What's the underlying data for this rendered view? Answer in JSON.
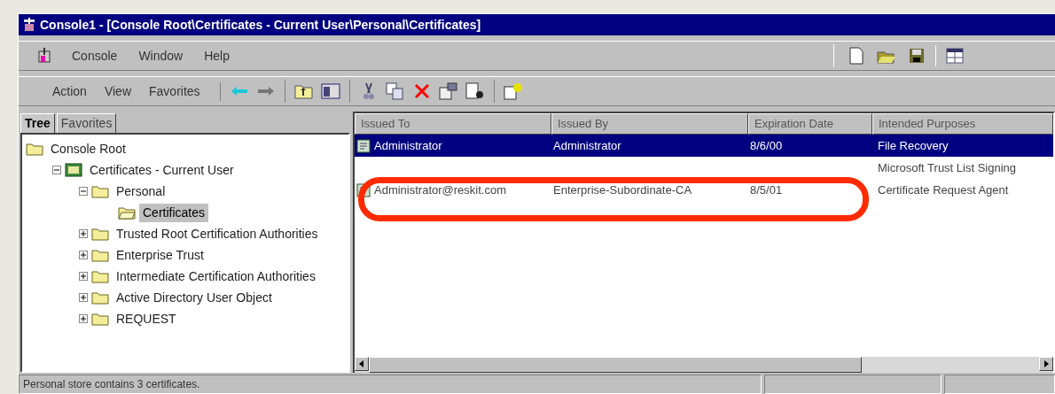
{
  "window": {
    "title": "Console1 - [Console Root\\Certificates - Current User\\Personal\\Certificates]"
  },
  "menu": [
    "Console",
    "Window",
    "Help"
  ],
  "action_menu": [
    "Action",
    "View",
    "Favorites"
  ],
  "tabs": [
    {
      "label": "Tree",
      "selected": true
    },
    {
      "label": "Favorites",
      "selected": false
    }
  ],
  "tree": [
    {
      "label": "Console Root",
      "kind": "folder",
      "selected": false,
      "children": [
        {
          "label": "Certificates - Current User",
          "kind": "snapin",
          "expanded": true,
          "selected": false,
          "children": [
            {
              "label": "Personal",
              "kind": "folder",
              "expanded": true,
              "selected": false,
              "children": [
                {
                  "label": "Certificates",
                  "kind": "folder",
                  "selected": true
                }
              ]
            },
            {
              "label": "Trusted Root Certification Authorities",
              "kind": "folder",
              "expanded": false,
              "selected": false
            },
            {
              "label": "Enterprise Trust",
              "kind": "folder",
              "expanded": false,
              "selected": false
            },
            {
              "label": "Intermediate Certification Authorities",
              "kind": "folder",
              "expanded": false,
              "selected": false
            },
            {
              "label": "Active Directory User Object",
              "kind": "folder",
              "expanded": false,
              "selected": false
            },
            {
              "label": "REQUEST",
              "kind": "folder",
              "expanded": false,
              "selected": false
            }
          ]
        }
      ]
    }
  ],
  "table": {
    "columns": [
      "Issued To",
      "Issued By",
      "Expiration Date",
      "Intended Purposes"
    ],
    "rows": [
      {
        "cells": [
          "Administrator",
          "Administrator",
          "8/6/00",
          "File Recovery"
        ],
        "selected": true
      },
      {
        "cells": [
          "",
          "",
          "",
          "Microsoft Trust List Signing"
        ],
        "selected": false
      },
      {
        "cells": [
          "Administrator@reskit.com",
          "Enterprise-Subordinate-CA",
          "8/5/01",
          "Certificate Request Agent"
        ],
        "selected": false
      }
    ]
  },
  "status_bar": "Personal store contains 3 certificates."
}
